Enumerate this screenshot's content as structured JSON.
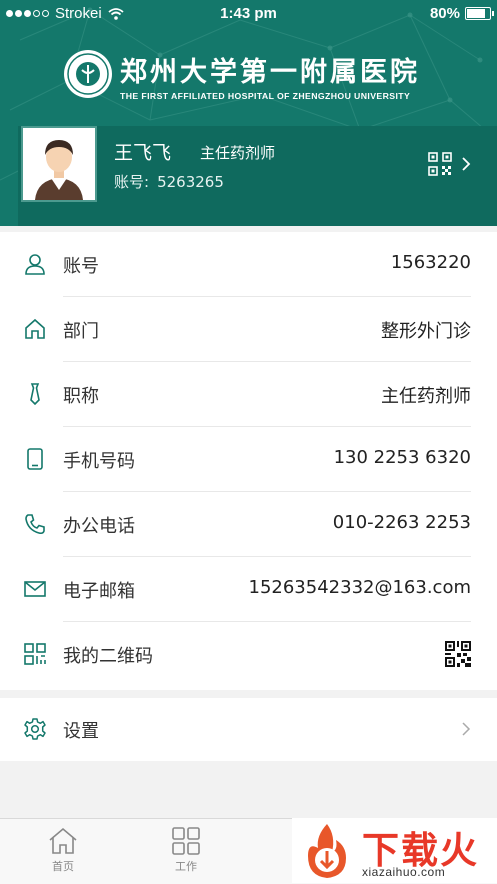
{
  "status_bar": {
    "carrier": "Strokei",
    "time": "1:43 pm",
    "battery": "80%",
    "battery_level": 0.8
  },
  "header": {
    "hospital_name": "郑州大学第一附属医院",
    "hospital_name_en": "THE FIRST AFFILIATED HOSPITAL OF ZHENGZHOU UNIVERSITY",
    "accent_color": "#14786b"
  },
  "profile": {
    "name": "王飞飞",
    "title": "主任药剂师",
    "account_label": "账号:",
    "account_value": "5263265"
  },
  "info_rows": [
    {
      "icon": "user-icon",
      "label": "账号",
      "value": "1563220"
    },
    {
      "icon": "home-icon",
      "label": "部门",
      "value": "整形外门诊"
    },
    {
      "icon": "tie-icon",
      "label": "职称",
      "value": "主任药剂师"
    },
    {
      "icon": "phone-icon",
      "label": "手机号码",
      "value": "130 2253 6320"
    },
    {
      "icon": "telephone-icon",
      "label": "办公电话",
      "value": "010-2263 2253"
    },
    {
      "icon": "mail-icon",
      "label": "电子邮箱",
      "value": "15263542332@163.com"
    },
    {
      "icon": "qrcode-icon",
      "label": "我的二维码",
      "value": ""
    }
  ],
  "settings": {
    "icon": "gear-icon",
    "label": "设置"
  },
  "tabbar": {
    "tabs": [
      {
        "icon": "home-icon",
        "label": "首页"
      },
      {
        "icon": "grid-icon",
        "label": "工作"
      }
    ]
  },
  "watermark": {
    "text": "下载火",
    "url": "xiazaihuo.com"
  }
}
